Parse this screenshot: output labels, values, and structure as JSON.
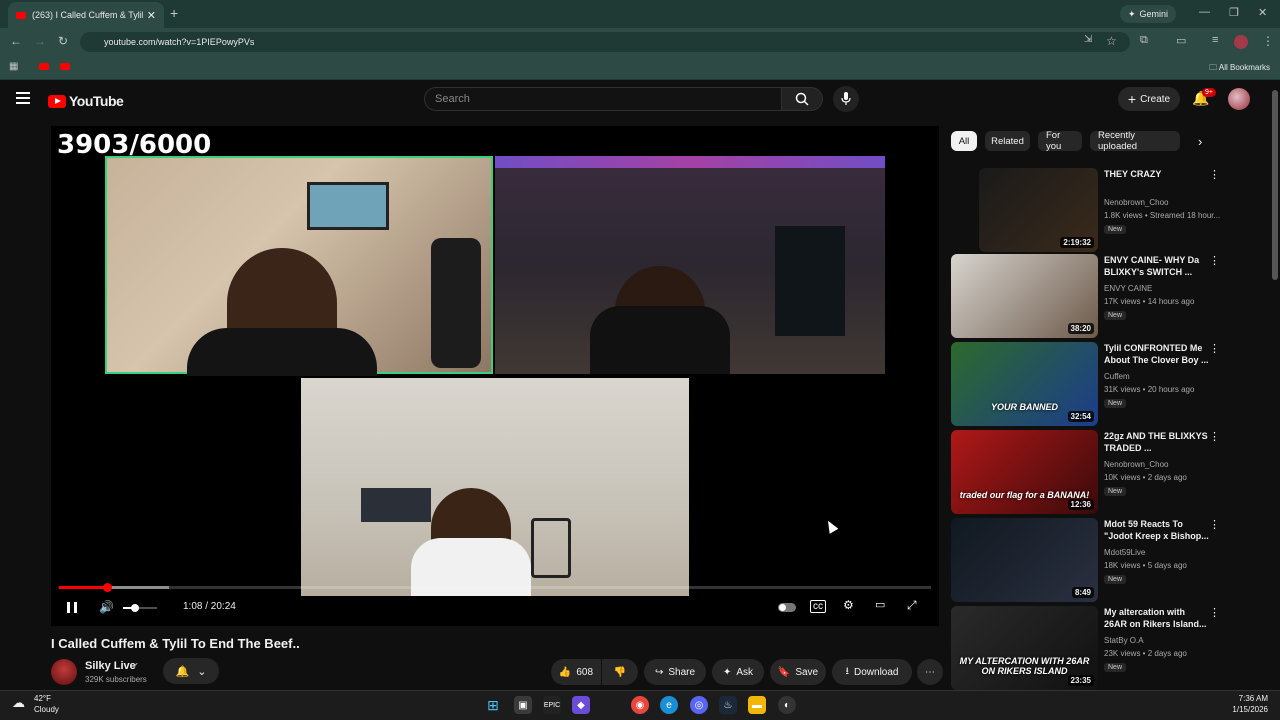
{
  "browser": {
    "tab_title": "(263) I Called Cuffem & Tylil",
    "tab_close": "✕",
    "new_tab": "+",
    "gemini_label": "Gemini",
    "url": "youtube.com/watch?v=1PIEPowyPVs",
    "all_bookmarks": "All Bookmarks"
  },
  "youtube": {
    "logo_text": "YouTube",
    "search_placeholder": "Search",
    "create_label": "Create",
    "notif_count": "9+"
  },
  "player": {
    "overlay_counter": "3903/6000",
    "time": "1:08 / 20:24",
    "progress_fraction": 0.055,
    "volume_fraction": 0.35
  },
  "video": {
    "title": "I Called Cuffem & Tylil To End The Beef..",
    "channel": "Silky Live",
    "verified": "✔",
    "subscribers": "329K subscribers",
    "likes": "608",
    "share_label": "Share",
    "ask_label": "Ask",
    "save_label": "Save",
    "download_label": "Download"
  },
  "chips": [
    "All",
    "Related",
    "For you",
    "Recently uploaded"
  ],
  "recommendations": [
    {
      "title": "THEY CRAZY",
      "channel": "Nenobrown_Choo",
      "meta": "1.8K views • Streamed 18 hour...",
      "badge": "New",
      "duration": "2:19:32",
      "colors": [
        "#1a1a1a",
        "#3a2a1a"
      ]
    },
    {
      "title": "ENVY CAINE- WHY Da BLIXKY's SWITCH ...",
      "channel": "ENVY CAINE",
      "meta": "17K views • 14 hours ago",
      "badge": "New",
      "duration": "38:20",
      "colors": [
        "#d7d4cf",
        "#6d5a4a"
      ]
    },
    {
      "title": "Tylil CONFRONTED Me About The Clover Boy ...",
      "channel": "Cuffem",
      "meta": "31K views • 20 hours ago",
      "badge": "New",
      "duration": "32:54",
      "thumb_text": "YOUR BANNED",
      "colors": [
        "#2c6a2c",
        "#1c3c8c"
      ]
    },
    {
      "title": "22gz AND THE BLIXKYS  TRADED ...",
      "channel": "Nenobrown_Choo",
      "meta": "10K views • 2 days ago",
      "badge": "New",
      "duration": "12:36",
      "thumb_text": "traded our flag for a BANANA!",
      "colors": [
        "#b01818",
        "#3a0a0a"
      ]
    },
    {
      "title": "Mdot 59 Reacts To \"Jodot Kreep x Bishop...",
      "channel": "Mdot59Live",
      "meta": "18K views • 5 days ago",
      "badge": "New",
      "duration": "8:49",
      "colors": [
        "#101820",
        "#2a3040"
      ]
    },
    {
      "title": "My altercation with 26AR on Rikers Island...",
      "channel": "StatBy O.A",
      "meta": "23K views • 2 days ago",
      "badge": "New",
      "duration": "23:35",
      "thumb_text": "MY ALTERCATION WITH 26AR ON RIKERS ISLAND",
      "colors": [
        "#2a2a2a",
        "#111"
      ]
    }
  ],
  "taskbar": {
    "temp": "42°F",
    "weather": "Cloudy",
    "time": "7:36 AM",
    "date": "1/15/2026"
  }
}
